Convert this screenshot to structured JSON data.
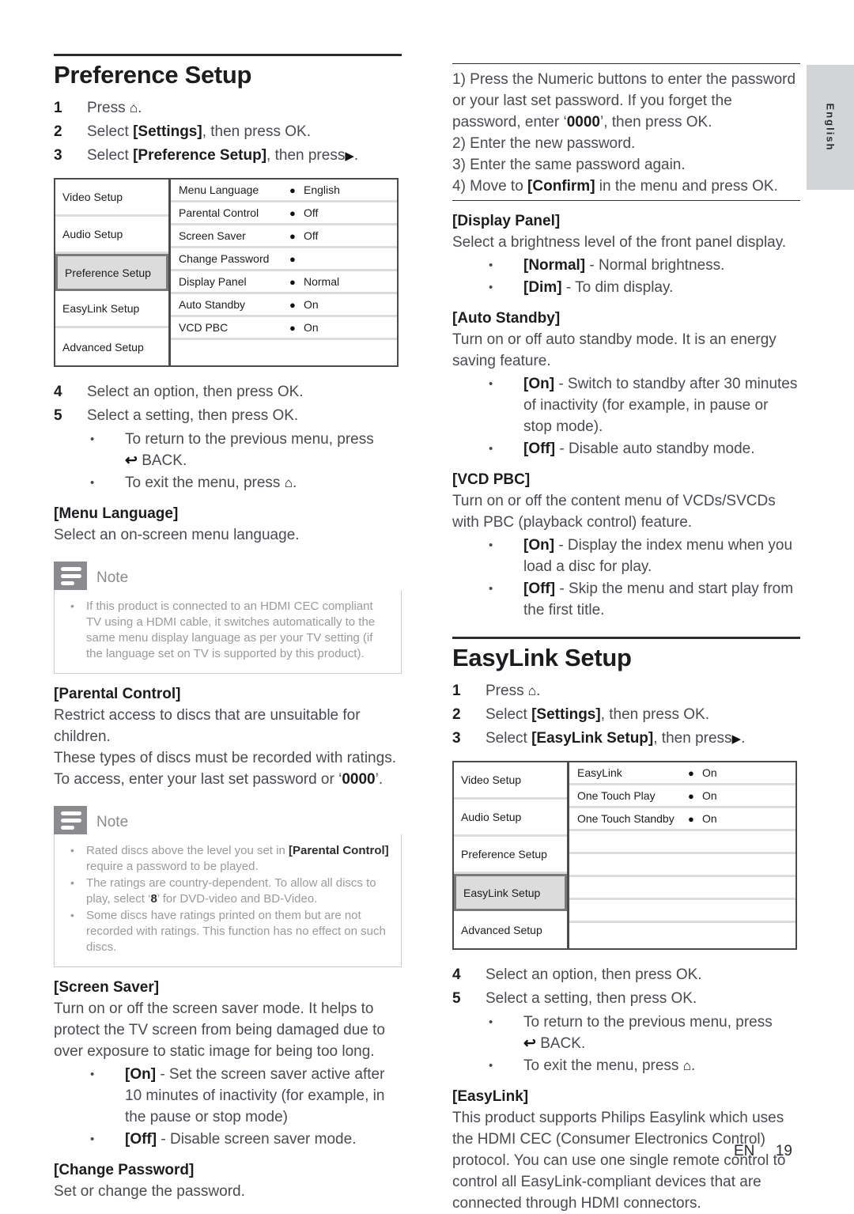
{
  "language_tab": {
    "label": "English"
  },
  "footer": {
    "lang_code": "EN",
    "page_number": "19"
  },
  "left_column": {
    "section_title": "Preference Setup",
    "steps": [
      {
        "num": "1",
        "text_before": "Press ",
        "glyph": "home-icon",
        "text_after": "."
      },
      {
        "num": "2",
        "text_before": "Select ",
        "bold": "[Settings]",
        "text_after": ", then press OK."
      },
      {
        "num": "3",
        "text_before": "Select ",
        "bold": "[Preference Setup]",
        "text_after": ", then press",
        "glyph": "right-arrow-icon",
        "tail": "."
      }
    ],
    "menu": {
      "left_items": [
        {
          "label": "Video Setup",
          "selected": false
        },
        {
          "label": "Audio Setup",
          "selected": false
        },
        {
          "label": "Preference Setup",
          "selected": true
        },
        {
          "label": "EasyLink Setup",
          "selected": false
        },
        {
          "label": "Advanced Setup",
          "selected": false
        }
      ],
      "right_items": [
        {
          "label": "Menu Language",
          "value": "English"
        },
        {
          "label": "Parental Control",
          "value": "Off"
        },
        {
          "label": "Screen Saver",
          "value": "Off"
        },
        {
          "label": "Change Password",
          "value": ""
        },
        {
          "label": "Display Panel",
          "value": "Normal"
        },
        {
          "label": "Auto Standby",
          "value": "On"
        },
        {
          "label": "VCD PBC",
          "value": "On"
        },
        {
          "label": "",
          "value": ""
        }
      ]
    },
    "steps2": [
      {
        "num": "4",
        "text": "Select an option, then press OK."
      },
      {
        "num": "5",
        "text": "Select a setting, then press OK."
      }
    ],
    "steps2_bullets": [
      "To return to the previous menu, press",
      "BACK.",
      "To exit the menu, press"
    ],
    "menu_language": {
      "heading": "[Menu Language]",
      "body": "Select an on-screen menu language."
    },
    "note1": {
      "title": "Note",
      "items": [
        "If this product is connected to an HDMI CEC compliant TV using a HDMI cable, it switches automatically to the same menu display language as per your TV setting (if the language set on TV is supported by this product)."
      ]
    },
    "parental_control": {
      "heading": "[Parental Control]",
      "body_lines": [
        "Restrict access to discs that are unsuitable for children.",
        "These types of discs must be recorded with ratings.",
        "To access, enter your last set password or ‘0000’."
      ],
      "password_default": "0000"
    },
    "note2": {
      "title": "Note",
      "items": [
        {
          "pre": "Rated discs above the level you set in ",
          "bold": "[Parental Control]",
          "post": " require a password to be played."
        },
        {
          "pre": "The ratings are country-dependent. To allow all discs to play, select ‘",
          "bold": "8",
          "post": "’ for DVD-video and BD-Video."
        },
        {
          "pre": "Some discs have ratings printed on them but are not recorded with ratings. This function has no effect on such discs.",
          "bold": "",
          "post": ""
        }
      ]
    },
    "screen_saver": {
      "heading": "[Screen Saver]",
      "body": "Turn on or off the screen saver mode. It helps to protect the TV screen from being damaged due to over exposure to static image for being too long.",
      "bullets": [
        {
          "bold": "[On]",
          "text": " - Set the screen saver active after 10 minutes of inactivity (for example, in the pause or stop mode)"
        },
        {
          "bold": "[Off]",
          "text": " - Disable screen saver mode."
        }
      ]
    },
    "change_password": {
      "heading": "[Change Password]",
      "body": "Set or change the password."
    }
  },
  "right_column": {
    "password_steps": {
      "lines": [
        {
          "pre": "1) Press the Numeric buttons to enter the password or your last set password. If you forget the password, enter ‘",
          "bold": "0000",
          "post": "’, then press OK."
        },
        {
          "pre": "2) Enter the new password.",
          "bold": "",
          "post": ""
        },
        {
          "pre": "3) Enter the same password again.",
          "bold": "",
          "post": ""
        },
        {
          "pre": "4) Move to ",
          "bold": "[Confirm]",
          "post": " in the menu and press OK."
        }
      ]
    },
    "display_panel": {
      "heading": "[Display Panel]",
      "body": "Select a brightness level of the front panel display.",
      "bullets": [
        {
          "bold": "[Normal]",
          "text": " - Normal brightness."
        },
        {
          "bold": "[Dim]",
          "text": " - To dim display."
        }
      ]
    },
    "auto_standby": {
      "heading": "[Auto Standby]",
      "body": "Turn on or off auto standby mode. It is an energy saving feature.",
      "bullets": [
        {
          "bold": "[On]",
          "text": " - Switch to standby after 30 minutes of inactivity (for example, in pause or stop mode)."
        },
        {
          "bold": "[Off]",
          "text": " - Disable auto standby mode."
        }
      ]
    },
    "vcd_pbc": {
      "heading": "[VCD PBC]",
      "body": "Turn on or off the content menu of VCDs/SVCDs with PBC (playback control) feature.",
      "bullets": [
        {
          "bold": "[On]",
          "text": " - Display the index menu when you load a disc for play."
        },
        {
          "bold": "[Off]",
          "text": " - Skip the menu and start play from the first title."
        }
      ]
    },
    "section_title": "EasyLink Setup",
    "steps": [
      {
        "num": "1",
        "text_before": "Press ",
        "glyph": "home-icon",
        "text_after": "."
      },
      {
        "num": "2",
        "text_before": "Select ",
        "bold": "[Settings]",
        "text_after": ", then press OK."
      },
      {
        "num": "3",
        "text_before": "Select ",
        "bold": "[EasyLink Setup]",
        "text_after": ", then press",
        "glyph": "right-arrow-icon",
        "tail": "."
      }
    ],
    "menu": {
      "left_items": [
        {
          "label": "Video Setup",
          "selected": false
        },
        {
          "label": "Audio Setup",
          "selected": false
        },
        {
          "label": "Preference Setup",
          "selected": false
        },
        {
          "label": "EasyLink Setup",
          "selected": true
        },
        {
          "label": "Advanced Setup",
          "selected": false
        }
      ],
      "right_items": [
        {
          "label": "EasyLink",
          "value": "On"
        },
        {
          "label": "One Touch Play",
          "value": "On"
        },
        {
          "label": "One Touch Standby",
          "value": "On"
        },
        {
          "label": "",
          "value": ""
        },
        {
          "label": "",
          "value": ""
        },
        {
          "label": "",
          "value": ""
        },
        {
          "label": "",
          "value": ""
        },
        {
          "label": "",
          "value": ""
        }
      ]
    },
    "steps2": [
      {
        "num": "4",
        "text": "Select an option, then press OK."
      },
      {
        "num": "5",
        "text": "Select a setting, then press OK."
      }
    ],
    "steps2_bullets": [
      "To return to the previous menu, press",
      "BACK.",
      "To exit the menu, press"
    ],
    "easylink": {
      "heading": "[EasyLink]",
      "body": "This product supports Philips Easylink which uses the HDMI CEC (Consumer Electronics Control) protocol. You can use one single remote control to control all EasyLink-compliant devices that are connected through HDMI connectors."
    }
  },
  "icons": {
    "home": "⌂",
    "right_arrow": "▶",
    "back": "↶",
    "bullet_dot": "●"
  }
}
